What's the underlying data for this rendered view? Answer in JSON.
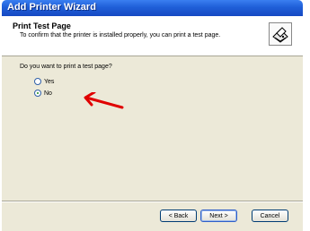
{
  "window": {
    "title": "Add Printer Wizard"
  },
  "header": {
    "title": "Print Test Page",
    "subtitle": "To confirm that the printer is installed properly, you can print a test page.",
    "icon": "printer-icon"
  },
  "question": "Do you want to print a test page?",
  "options": [
    {
      "label": "Yes",
      "selected": false
    },
    {
      "label": "No",
      "selected": true
    }
  ],
  "annotation": {
    "icon": "red-arrow-icon",
    "color": "#e00000"
  },
  "buttons": {
    "back": "< Back",
    "next": "Next >",
    "cancel": "Cancel"
  }
}
